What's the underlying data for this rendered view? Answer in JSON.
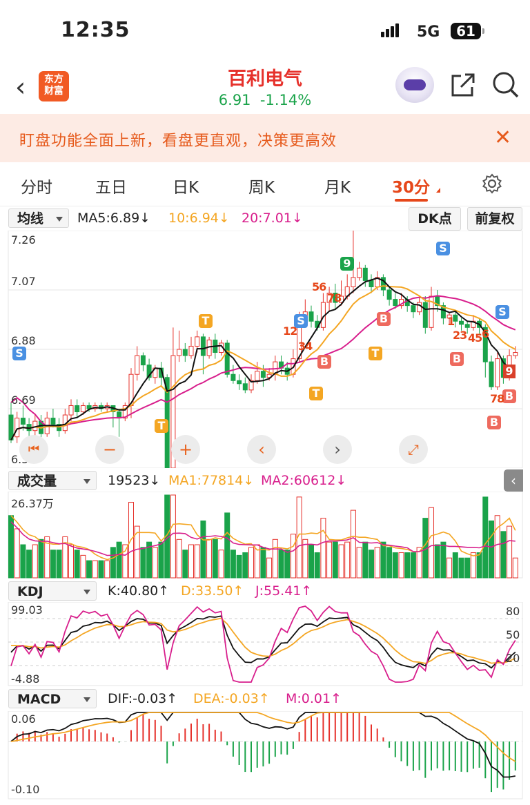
{
  "status_bar": {
    "time": "12:35",
    "network": "5G",
    "battery": "61"
  },
  "header": {
    "logo_line1": "东方",
    "logo_line2": "财富",
    "stock_name": "百利电气",
    "price": "6.91",
    "change": "-1.14%"
  },
  "banner": {
    "text": "盯盘功能全面上新，看盘更直观，决策更高效"
  },
  "tabs": [
    {
      "label": "分时"
    },
    {
      "label": "五日"
    },
    {
      "label": "日K"
    },
    {
      "label": "周K"
    },
    {
      "label": "月K"
    },
    {
      "label": "30分"
    }
  ],
  "main_indicator": {
    "selector": "均线",
    "ma5": "MA5:6.89↓",
    "ma10": "10:6.94↓",
    "ma20": "20:7.01↓",
    "dk_button": "DK点",
    "adjust_button": "前复权"
  },
  "price_axis": {
    "top": "7.26",
    "l2": "7.07",
    "l3": "6.88",
    "l4": "6.69",
    "bottom": "6.50"
  },
  "markers": {
    "S": "S",
    "T": "T",
    "B": "B",
    "n12": "12",
    "n34": "34",
    "n56": "56",
    "n78": "78",
    "n9": "9",
    "n1": "1",
    "n23": "23",
    "n45": "45",
    "n6": "6",
    "n78b": "78",
    "n9b": "9"
  },
  "volume": {
    "selector": "成交量",
    "value": "19523↓",
    "ma1": "MA1:77814↓",
    "ma2": "MA2:60612↓",
    "axis_top": "26.37万"
  },
  "kdj": {
    "selector": "KDJ",
    "k": "K:40.80↑",
    "d": "D:33.50↑",
    "j": "J:55.41↑",
    "axis_top": "99.03",
    "axis_bottom": "-4.88",
    "r80": "80",
    "r50": "50",
    "r20": "20"
  },
  "macd": {
    "selector": "MACD",
    "dif": "DIF:-0.03↑",
    "dea": "DEA:-0.03↑",
    "m": "M:0.01↑",
    "axis_top": "0.06",
    "axis_bottom": "-0.10"
  },
  "colors": {
    "up": "#e6312b",
    "down": "#1aa34a",
    "ma5": "#111111",
    "ma10": "#f4a623",
    "ma20": "#d81e8c",
    "accent": "#e6471a"
  },
  "chart_data": {
    "type": "candlestick",
    "interval": "30分",
    "ylim": [
      6.5,
      7.26
    ],
    "candles": [
      [
        6.67,
        6.59,
        6.71,
        6.58
      ],
      [
        6.6,
        6.66,
        6.68,
        6.58
      ],
      [
        6.66,
        6.64,
        6.7,
        6.62
      ],
      [
        6.64,
        6.62,
        6.66,
        6.6
      ],
      [
        6.62,
        6.65,
        6.67,
        6.6
      ],
      [
        6.65,
        6.61,
        6.67,
        6.59
      ],
      [
        6.61,
        6.66,
        6.68,
        6.6
      ],
      [
        6.66,
        6.64,
        6.69,
        6.63
      ],
      [
        6.64,
        6.62,
        6.66,
        6.6
      ],
      [
        6.62,
        6.67,
        6.69,
        6.61
      ],
      [
        6.67,
        6.7,
        6.72,
        6.65
      ],
      [
        6.7,
        6.68,
        6.72,
        6.66
      ],
      [
        6.68,
        6.7,
        6.71,
        6.67
      ],
      [
        6.7,
        6.69,
        6.71,
        6.68
      ],
      [
        6.69,
        6.7,
        6.71,
        6.68
      ],
      [
        6.7,
        6.69,
        6.71,
        6.68
      ],
      [
        6.69,
        6.7,
        6.71,
        6.68
      ],
      [
        6.7,
        6.68,
        6.7,
        6.63
      ],
      [
        6.68,
        6.66,
        6.69,
        6.6
      ],
      [
        6.66,
        6.7,
        6.71,
        6.65
      ],
      [
        6.7,
        6.8,
        6.82,
        6.66
      ],
      [
        6.8,
        6.86,
        6.89,
        6.78
      ],
      [
        6.86,
        6.83,
        6.87,
        6.81
      ],
      [
        6.83,
        6.79,
        6.85,
        6.78
      ],
      [
        6.79,
        6.82,
        6.83,
        6.77
      ],
      [
        6.82,
        6.79,
        6.84,
        6.76
      ],
      [
        6.79,
        6.5,
        6.8,
        6.5
      ],
      [
        6.5,
        6.86,
        6.95,
        6.5
      ],
      [
        6.86,
        6.88,
        6.94,
        6.84
      ],
      [
        6.88,
        6.86,
        6.9,
        6.84
      ],
      [
        6.86,
        6.89,
        6.92,
        6.85
      ],
      [
        6.89,
        6.92,
        6.94,
        6.87
      ],
      [
        6.92,
        6.86,
        6.93,
        6.8
      ],
      [
        6.86,
        6.91,
        6.92,
        6.85
      ],
      [
        6.91,
        6.87,
        6.93,
        6.85
      ],
      [
        6.87,
        6.9,
        6.91,
        6.86
      ],
      [
        6.9,
        6.8,
        6.91,
        6.79
      ],
      [
        6.8,
        6.78,
        6.83,
        6.77
      ],
      [
        6.78,
        6.77,
        6.8,
        6.75
      ],
      [
        6.77,
        6.75,
        6.79,
        6.74
      ],
      [
        6.75,
        6.78,
        6.8,
        6.74
      ],
      [
        6.78,
        6.81,
        6.84,
        6.77
      ],
      [
        6.81,
        6.79,
        6.83,
        6.76
      ],
      [
        6.79,
        6.8,
        6.82,
        6.78
      ],
      [
        6.8,
        6.84,
        6.86,
        6.78
      ],
      [
        6.84,
        6.82,
        6.86,
        6.8
      ],
      [
        6.82,
        6.8,
        6.84,
        6.78
      ],
      [
        6.8,
        6.85,
        6.88,
        6.79
      ],
      [
        6.85,
        6.97,
        7.0,
        6.84
      ],
      [
        6.97,
        7.0,
        7.04,
        6.95
      ],
      [
        7.0,
        6.97,
        7.02,
        6.95
      ],
      [
        6.97,
        6.95,
        6.99,
        6.94
      ],
      [
        6.95,
        7.03,
        7.06,
        6.94
      ],
      [
        7.03,
        7.06,
        7.08,
        7.0
      ],
      [
        7.06,
        7.03,
        7.09,
        7.01
      ],
      [
        7.03,
        7.05,
        7.1,
        7.02
      ],
      [
        7.05,
        7.08,
        7.12,
        7.04
      ],
      [
        7.08,
        7.11,
        7.26,
        7.06
      ],
      [
        7.11,
        7.14,
        7.16,
        7.1
      ],
      [
        7.14,
        7.1,
        7.15,
        7.08
      ],
      [
        7.1,
        7.08,
        7.12,
        7.06
      ],
      [
        7.08,
        7.11,
        7.13,
        7.07
      ],
      [
        7.11,
        7.07,
        7.12,
        7.05
      ],
      [
        7.07,
        7.04,
        7.08,
        7.02
      ],
      [
        7.04,
        7.02,
        7.06,
        7.01
      ],
      [
        7.02,
        7.04,
        7.06,
        7.01
      ],
      [
        7.04,
        7.02,
        7.05,
        7.0
      ],
      [
        7.02,
        7.0,
        7.03,
        6.98
      ],
      [
        7.0,
        7.03,
        7.05,
        6.99
      ],
      [
        7.03,
        6.95,
        7.05,
        6.93
      ],
      [
        6.95,
        7.05,
        7.08,
        6.94
      ],
      [
        7.05,
        7.02,
        7.07,
        7.0
      ],
      [
        7.02,
        6.98,
        7.03,
        6.96
      ],
      [
        6.98,
        6.99,
        7.0,
        6.96
      ],
      [
        6.99,
        6.97,
        7.0,
        6.95
      ],
      [
        6.97,
        6.96,
        6.98,
        6.94
      ],
      [
        6.96,
        6.95,
        6.97,
        6.93
      ],
      [
        6.95,
        6.97,
        6.99,
        6.94
      ],
      [
        6.97,
        6.95,
        6.98,
        6.93
      ],
      [
        6.95,
        6.84,
        6.96,
        6.79
      ],
      [
        6.84,
        6.76,
        6.86,
        6.75
      ],
      [
        6.76,
        6.85,
        6.87,
        6.75
      ],
      [
        6.85,
        6.79,
        6.86,
        6.77
      ],
      [
        6.79,
        6.86,
        6.88,
        6.78
      ],
      [
        6.86,
        6.87,
        6.89,
        6.85
      ]
    ]
  }
}
